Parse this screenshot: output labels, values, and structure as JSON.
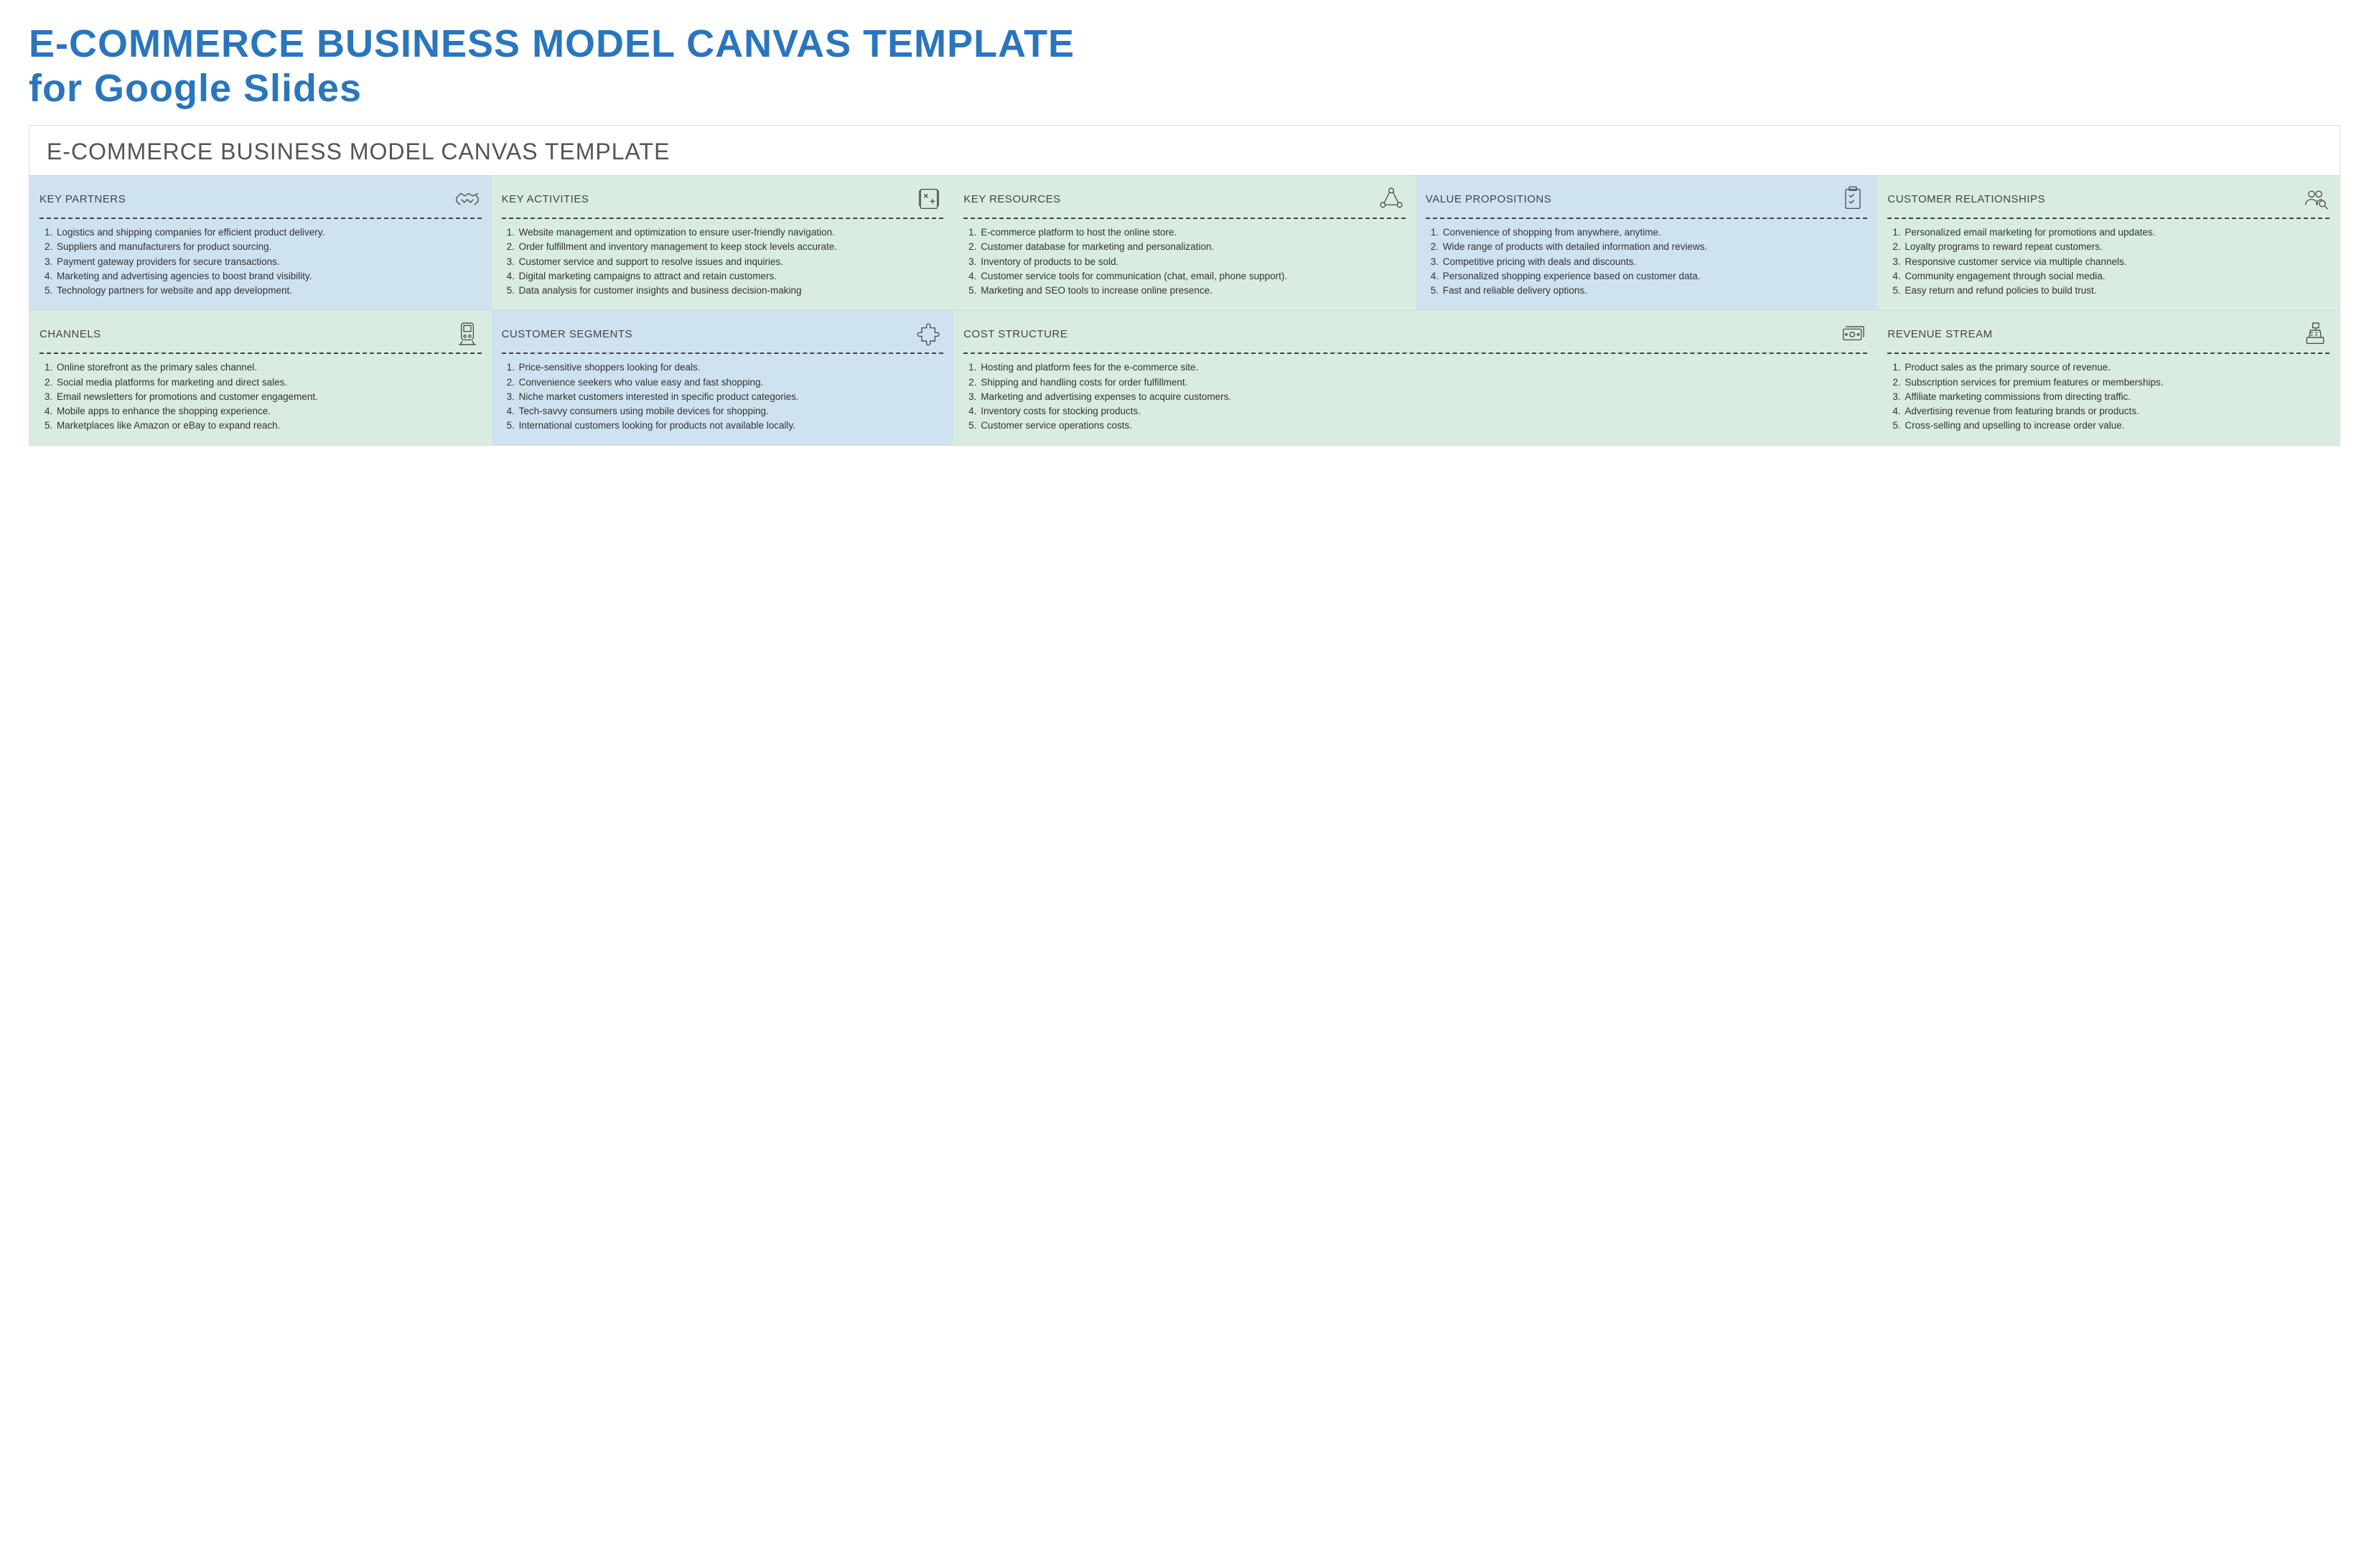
{
  "page_title_line1": "E-COMMERCE BUSINESS MODEL CANVAS TEMPLATE",
  "page_title_line2": "for Google Slides",
  "canvas_title": "E-COMMERCE BUSINESS MODEL CANVAS TEMPLATE",
  "row1": {
    "key_partners": {
      "title": "KEY PARTNERS",
      "items": [
        "Logistics and shipping companies for efficient product delivery.",
        "Suppliers and manufacturers for product sourcing.",
        "Payment gateway providers for secure transactions.",
        "Marketing and advertising agencies to boost brand visibility.",
        "Technology partners for website and app development."
      ]
    },
    "key_activities": {
      "title": "KEY ACTIVITIES",
      "items": [
        "Website management and optimization to ensure user-friendly navigation.",
        "Order fulfillment and inventory management to keep stock levels accurate.",
        "Customer service and support to resolve issues and inquiries.",
        "Digital marketing campaigns to attract and retain customers.",
        "Data analysis for customer insights and business decision-making"
      ]
    },
    "key_resources": {
      "title": "KEY RESOURCES",
      "items": [
        "E-commerce platform to host the online store.",
        "Customer database for marketing and personalization.",
        "Inventory of products to be sold.",
        "Customer service tools for communication (chat, email, phone support).",
        "Marketing and SEO tools to increase online presence."
      ]
    },
    "value_propositions": {
      "title": "VALUE PROPOSITIONS",
      "items": [
        "Convenience of shopping from anywhere, anytime.",
        "Wide range of products with detailed information and reviews.",
        "Competitive pricing with deals and discounts.",
        "Personalized shopping experience based on customer data.",
        "Fast and reliable delivery options."
      ]
    },
    "customer_relationships": {
      "title": "CUSTOMER RELATIONSHIPS",
      "items": [
        "Personalized email marketing for promotions and updates.",
        "Loyalty programs to reward repeat customers.",
        "Responsive customer service via multiple channels.",
        "Community engagement through social media.",
        "Easy return and refund policies to build trust."
      ]
    }
  },
  "row2": {
    "channels": {
      "title": "CHANNELS",
      "items": [
        "Online storefront as the primary sales channel.",
        "Social media platforms for marketing and direct sales.",
        "Email newsletters for promotions and customer engagement.",
        "Mobile apps to enhance the shopping experience.",
        "Marketplaces like Amazon or eBay to expand reach."
      ]
    },
    "customer_segments": {
      "title": "CUSTOMER SEGMENTS",
      "items": [
        "Price-sensitive shoppers looking for deals.",
        "Convenience seekers who value easy and fast shopping.",
        "Niche market customers interested in specific product categories.",
        "Tech-savvy consumers using mobile devices for shopping.",
        "International customers looking for products not available locally."
      ]
    },
    "cost_structure": {
      "title": "COST STRUCTURE",
      "items": [
        "Hosting and platform fees for the e-commerce site.",
        "Shipping and handling costs for order fulfillment.",
        "Marketing and advertising expenses to acquire customers.",
        "Inventory costs for stocking products.",
        "Customer service operations costs."
      ]
    },
    "revenue_stream": {
      "title": "REVENUE STREAM",
      "items": [
        "Product sales as the primary source of revenue.",
        "Subscription services for premium features or memberships.",
        "Affiliate marketing commissions from directing traffic.",
        "Advertising revenue from featuring brands or products.",
        "Cross-selling and upselling to increase order value."
      ]
    }
  }
}
